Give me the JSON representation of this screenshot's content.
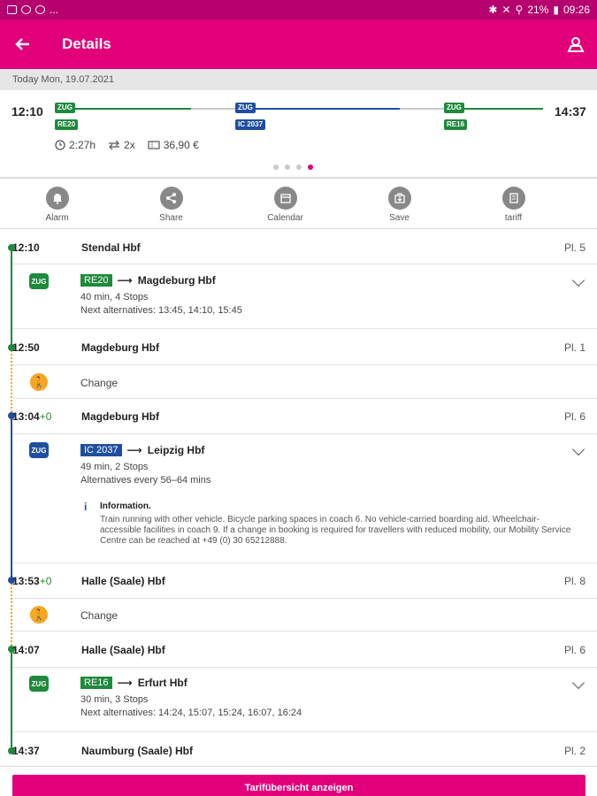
{
  "status_bar": {
    "left_dots": "...",
    "battery": "21%",
    "time": "09:26"
  },
  "app_bar": {
    "title": "Details"
  },
  "date_label": "Today Mon, 19.07.2021",
  "overview": {
    "depart": "12:10",
    "arrive": "14:37",
    "segments": [
      {
        "badge": "ZUG",
        "label": "RE20",
        "color": "#1e8a3c"
      },
      {
        "badge": "ZUG",
        "label": "IC 2037",
        "color": "#1f4fa0"
      },
      {
        "badge": "ZUG",
        "label": "RE16",
        "color": "#1e8a3c"
      }
    ],
    "duration": "2:27h",
    "changes": "2x",
    "price": "36,90 €",
    "pager": {
      "total": 4,
      "active": 4
    }
  },
  "actions": [
    {
      "label": "Alarm",
      "icon": "bell-icon"
    },
    {
      "label": "Share",
      "icon": "share-icon"
    },
    {
      "label": "Calendar",
      "icon": "calendar-icon"
    },
    {
      "label": "Save",
      "icon": "save-icon"
    },
    {
      "label": "tariff",
      "icon": "tariff-icon"
    }
  ],
  "journey": {
    "stops": [
      {
        "time": "12:10",
        "delay": "",
        "name": "Stendal Hbf",
        "platform": "Pl. 5"
      },
      {
        "time": "12:50",
        "delay": "",
        "name": "Magdeburg Hbf",
        "platform": "Pl. 1"
      },
      {
        "time": "13:04",
        "delay": "+0",
        "name": "Magdeburg Hbf",
        "platform": "Pl. 6"
      },
      {
        "time": "13:53",
        "delay": "+0",
        "name": "Halle (Saale) Hbf",
        "platform": "Pl. 8"
      },
      {
        "time": "14:07",
        "delay": "",
        "name": "Halle (Saale) Hbf",
        "platform": "Pl. 6"
      },
      {
        "time": "14:37",
        "delay": "",
        "name": "Naumburg (Saale) Hbf",
        "platform": "Pl. 2"
      }
    ],
    "legs": [
      {
        "badge": "ZUG",
        "train": "RE20",
        "arrow": "⟶",
        "destination": "Magdeburg Hbf",
        "summary": "40 min, 4 Stops",
        "alternatives": "Next alternatives: 13:45, 14:10, 15:45",
        "color": "#1e8a3c"
      },
      {
        "badge": "ZUG",
        "train": "IC 2037",
        "arrow": "⟶",
        "destination": "Leipzig Hbf",
        "summary": "49 min, 2 Stops",
        "alternatives": "Alternatives every 56–64 mins",
        "color": "#1f4fa0",
        "info_title": "Information.",
        "info_text": "Train running with other vehicle. Bicycle parking spaces in coach 6. No vehicle-carried boarding aid. Wheelchair-accessible facilities in coach 9. If a change in booking is required for travellers with reduced mobility, our Mobility Service Centre can be reached at +49 (0) 30 65212888."
      },
      {
        "badge": "ZUG",
        "train": "RE16",
        "arrow": "⟶",
        "destination": "Erfurt Hbf",
        "summary": "30 min, 3 Stops",
        "alternatives": "Next alternatives: 14:24, 15:07, 15:24, 16:07, 16:24",
        "color": "#1e8a3c"
      }
    ],
    "change_label": "Change"
  },
  "bottom_button": "Tarifübersicht anzeigen"
}
